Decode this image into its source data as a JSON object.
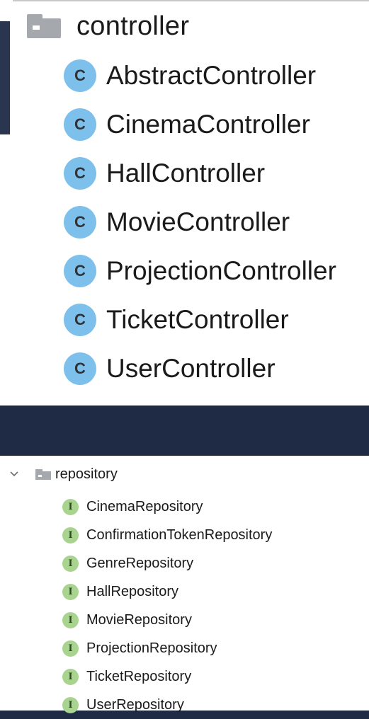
{
  "controller": {
    "folder_label": "controller",
    "folder_icon": "folder-icon",
    "class_icon_glyph": "C",
    "class_icon_color": "#7ec0ec",
    "items": [
      {
        "label": "AbstractController"
      },
      {
        "label": "CinemaController"
      },
      {
        "label": "HallController"
      },
      {
        "label": "MovieController"
      },
      {
        "label": "ProjectionController"
      },
      {
        "label": "TicketController"
      },
      {
        "label": "UserController"
      }
    ]
  },
  "repository": {
    "folder_label": "repository",
    "folder_icon": "folder-icon",
    "expand_icon": "chevron-down-icon",
    "interface_icon_glyph": "I",
    "interface_icon_color": "#a8d48f",
    "items": [
      {
        "label": "CinemaRepository"
      },
      {
        "label": "ConfirmationTokenRepository"
      },
      {
        "label": "GenreRepository"
      },
      {
        "label": "HallRepository"
      },
      {
        "label": "MovieRepository"
      },
      {
        "label": "ProjectionRepository"
      },
      {
        "label": "TicketRepository"
      },
      {
        "label": "UserRepository"
      }
    ]
  },
  "colors": {
    "background": "#1f2a44",
    "panel": "#ffffff",
    "folder": "#a5a9ad",
    "text": "#1a1a1a"
  }
}
